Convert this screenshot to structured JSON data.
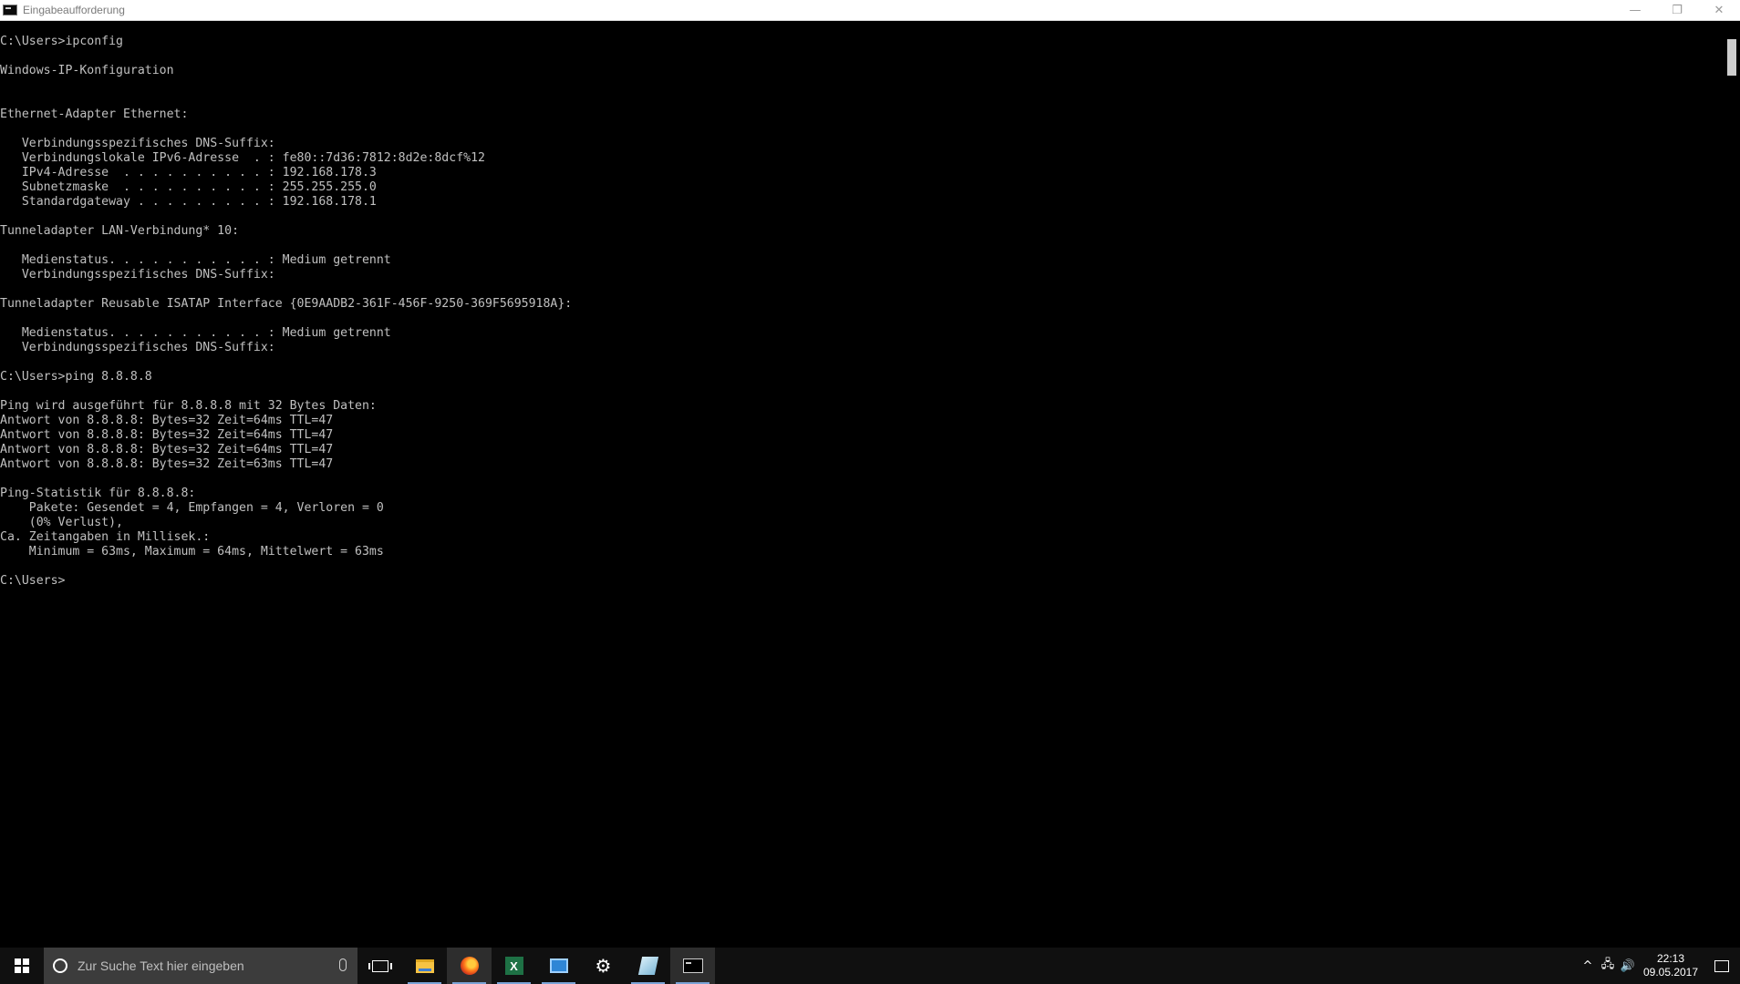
{
  "window": {
    "title": "Eingabeaufforderung",
    "controls": {
      "minimize": "—",
      "maximize": "❐",
      "close": "✕"
    }
  },
  "console": {
    "lines": [
      "C:\\Users>ipconfig",
      "",
      "Windows-IP-Konfiguration",
      "",
      "",
      "Ethernet-Adapter Ethernet:",
      "",
      "   Verbindungsspezifisches DNS-Suffix:",
      "   Verbindungslokale IPv6-Adresse  . : fe80::7d36:7812:8d2e:8dcf%12",
      "   IPv4-Adresse  . . . . . . . . . . : 192.168.178.3",
      "   Subnetzmaske  . . . . . . . . . . : 255.255.255.0",
      "   Standardgateway . . . . . . . . . : 192.168.178.1",
      "",
      "Tunneladapter LAN-Verbindung* 10:",
      "",
      "   Medienstatus. . . . . . . . . . . : Medium getrennt",
      "   Verbindungsspezifisches DNS-Suffix:",
      "",
      "Tunneladapter Reusable ISATAP Interface {0E9AADB2-361F-456F-9250-369F5695918A}:",
      "",
      "   Medienstatus. . . . . . . . . . . : Medium getrennt",
      "   Verbindungsspezifisches DNS-Suffix:",
      "",
      "C:\\Users>ping 8.8.8.8",
      "",
      "Ping wird ausgeführt für 8.8.8.8 mit 32 Bytes Daten:",
      "Antwort von 8.8.8.8: Bytes=32 Zeit=64ms TTL=47",
      "Antwort von 8.8.8.8: Bytes=32 Zeit=64ms TTL=47",
      "Antwort von 8.8.8.8: Bytes=32 Zeit=64ms TTL=47",
      "Antwort von 8.8.8.8: Bytes=32 Zeit=63ms TTL=47",
      "",
      "Ping-Statistik für 8.8.8.8:",
      "    Pakete: Gesendet = 4, Empfangen = 4, Verloren = 0",
      "    (0% Verlust),",
      "Ca. Zeitangaben in Millisek.:",
      "    Minimum = 63ms, Maximum = 64ms, Mittelwert = 63ms",
      "",
      "C:\\Users>"
    ]
  },
  "taskbar": {
    "search_placeholder": "Zur Suche Text hier eingeben",
    "apps": [
      {
        "name": "task-view",
        "icon": "task-view-icon"
      },
      {
        "name": "file-explorer",
        "icon": "folder-icon"
      },
      {
        "name": "firefox",
        "icon": "firefox-icon"
      },
      {
        "name": "excel",
        "icon": "excel-icon",
        "glyph": "X"
      },
      {
        "name": "network-app",
        "icon": "network-icon"
      },
      {
        "name": "settings",
        "icon": "gear-icon",
        "glyph": "⚙"
      },
      {
        "name": "notepad",
        "icon": "notepad-icon"
      },
      {
        "name": "command-prompt",
        "icon": "cmd-icon"
      }
    ],
    "tray": {
      "chevron": "^",
      "network_glyph": "🖧",
      "volume_glyph": "🔊",
      "time": "22:13",
      "date": "09.05.2017"
    }
  },
  "colors": {
    "console_bg": "#000000",
    "console_fg": "#c0c0c0",
    "taskbar_bg": "#101010",
    "accent": "#7aa3d6"
  }
}
